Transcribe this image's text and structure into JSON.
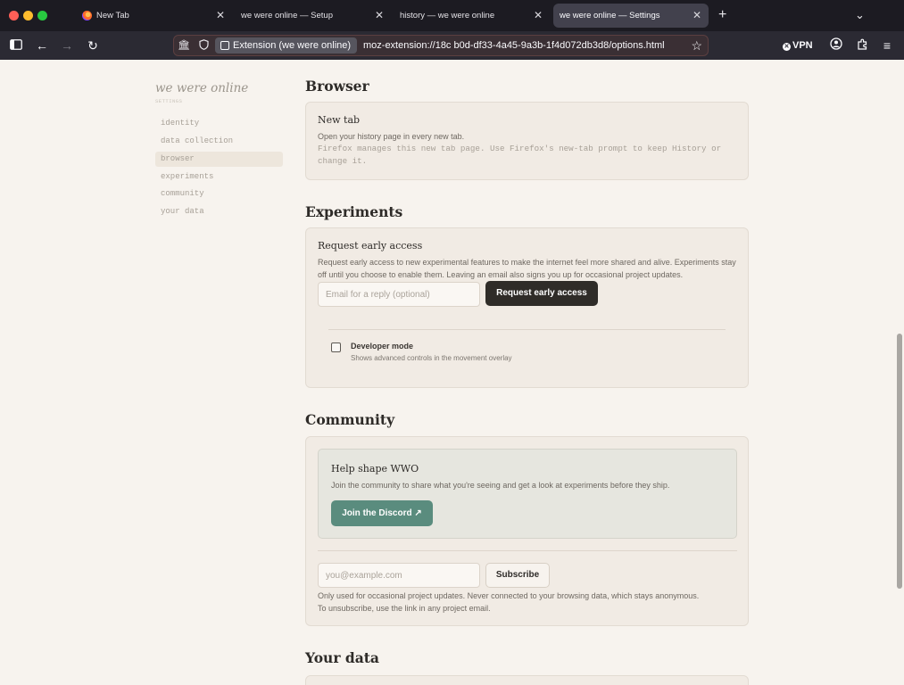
{
  "tabs": [
    {
      "title": "New Tab",
      "active": false,
      "has_favicon": true
    },
    {
      "title": "we were online — Setup",
      "active": false
    },
    {
      "title": "history — we were online",
      "active": false
    },
    {
      "title": "we were online — Settings",
      "active": true
    }
  ],
  "toolbar": {
    "extension_chip": "Extension (we were online)",
    "url": "moz-extension://18c  b0d-df33-4a45-9a3b-1f4d072db3d8/options.html",
    "vpn_label": "VPN"
  },
  "sidebar": {
    "brand": "we were online",
    "brand_sub": "SETTINGS",
    "items": [
      {
        "label": "identity",
        "active": false
      },
      {
        "label": "data collection",
        "active": false
      },
      {
        "label": "browser",
        "active": true
      },
      {
        "label": "experiments",
        "active": false
      },
      {
        "label": "community",
        "active": false
      },
      {
        "label": "your data",
        "active": false
      }
    ]
  },
  "browser_section": {
    "title": "Browser",
    "card_title": "New tab",
    "card_desc": "Open your history page in every new tab.",
    "card_note": "Firefox manages this new tab page. Use Firefox's new-tab prompt to keep History or change it."
  },
  "experiments_section": {
    "title": "Experiments",
    "card_title": "Request early access",
    "card_desc": "Request early access to new experimental features to make the internet feel more shared and alive. Experiments stay off until you choose to enable them. Leaving an email also signs you up for occasional project updates.",
    "email_placeholder": "Email for a reply (optional)",
    "request_button": "Request early access",
    "dev_mode_label": "Developer mode",
    "dev_mode_desc": "Shows advanced controls in the movement overlay",
    "dev_mode_checked": false
  },
  "community_section": {
    "title": "Community",
    "inner_title": "Help shape WWO",
    "inner_desc": "Join the community to share what you're seeing and get a look at experiments before they ship.",
    "discord_button": "Join the Discord ↗",
    "email_placeholder": "you@example.com",
    "subscribe_button": "Subscribe",
    "note_line1": "Only used for occasional project updates. Never connected to your browsing data, which stays anonymous.",
    "note_line2": "To unsubscribe, use the link in any project email."
  },
  "your_data_section": {
    "title": "Your data"
  },
  "colors": {
    "page_bg": "#f7f3ee",
    "card_bg": "#f1ebe4",
    "dark_button": "#2f2c28",
    "discord_green": "#5a8c7e"
  }
}
